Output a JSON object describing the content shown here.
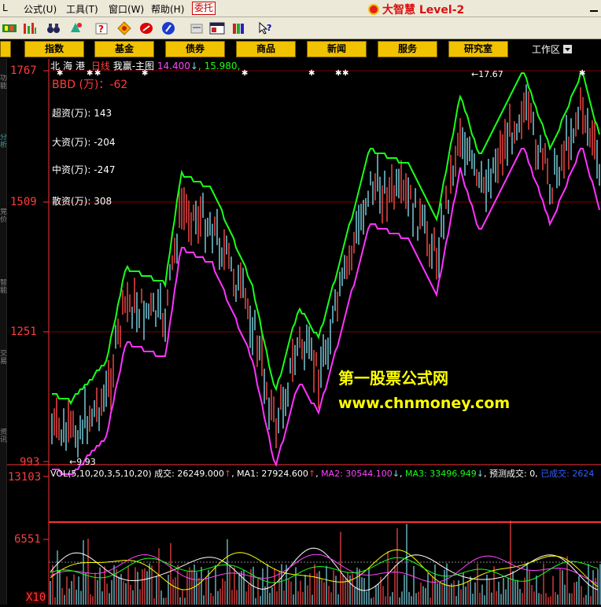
{
  "menu": {
    "items": [
      {
        "key": "L",
        "label": "L"
      },
      {
        "key": "formula",
        "label": "公式(U)"
      },
      {
        "key": "tools",
        "label": "工具(T)"
      },
      {
        "key": "window",
        "label": "窗口(W)"
      },
      {
        "key": "help",
        "label": "帮助(H)"
      }
    ],
    "weituo": "委托",
    "brand": "大智慧 Level-2"
  },
  "nav": {
    "buttons": [
      "指数",
      "基金",
      "债券",
      "商品",
      "新闻",
      "服务",
      "研究室"
    ],
    "workarea": "工作区"
  },
  "left_strip": [
    "功能",
    "分析",
    "竞价",
    "智能",
    "交易",
    "资讯"
  ],
  "chart": {
    "title_stock": "北海港",
    "period": "日线",
    "panel": "我赢-主图",
    "val1": "14.400",
    "arrow1": "↓",
    "val2": "15.980",
    "indicator": {
      "name": "BBD",
      "unit": "(万)",
      "value": "-62"
    },
    "indicators": [
      {
        "label": "超资(万):",
        "value": "143"
      },
      {
        "label": "大资(万):",
        "value": "-204"
      },
      {
        "label": "中资(万):",
        "value": "-247"
      },
      {
        "label": "散资(万):",
        "value": "308"
      }
    ],
    "price_axis": [
      "1767",
      "1509",
      "1251",
      "993"
    ],
    "high_label": "17.67",
    "low_label": "9.93",
    "watermark1": "第一股票公式网",
    "watermark2": "www.chnmoney.com",
    "vol_header": "VOL(5,10,20,3,5,10,20)",
    "vol_cj_label": "成交:",
    "vol_cj": "26249.000",
    "ma1_label": "MA1:",
    "ma1": "27924.600",
    "ma2_label": "MA2:",
    "ma2": "30544.100",
    "ma3_label": "MA3:",
    "ma3": "33496.949",
    "predict_label": "预测成交:",
    "predict": "0,",
    "done_label": "已成交:",
    "done": "2624",
    "vol_axis": [
      "13103",
      "6551",
      "X10"
    ]
  },
  "colors": {
    "up": "#ff4a4a",
    "down": "#7fd8e8",
    "green": "#19ff19",
    "magenta": "#ff33ff",
    "axis": "#ff3030",
    "yellow": "#ffff00"
  }
}
